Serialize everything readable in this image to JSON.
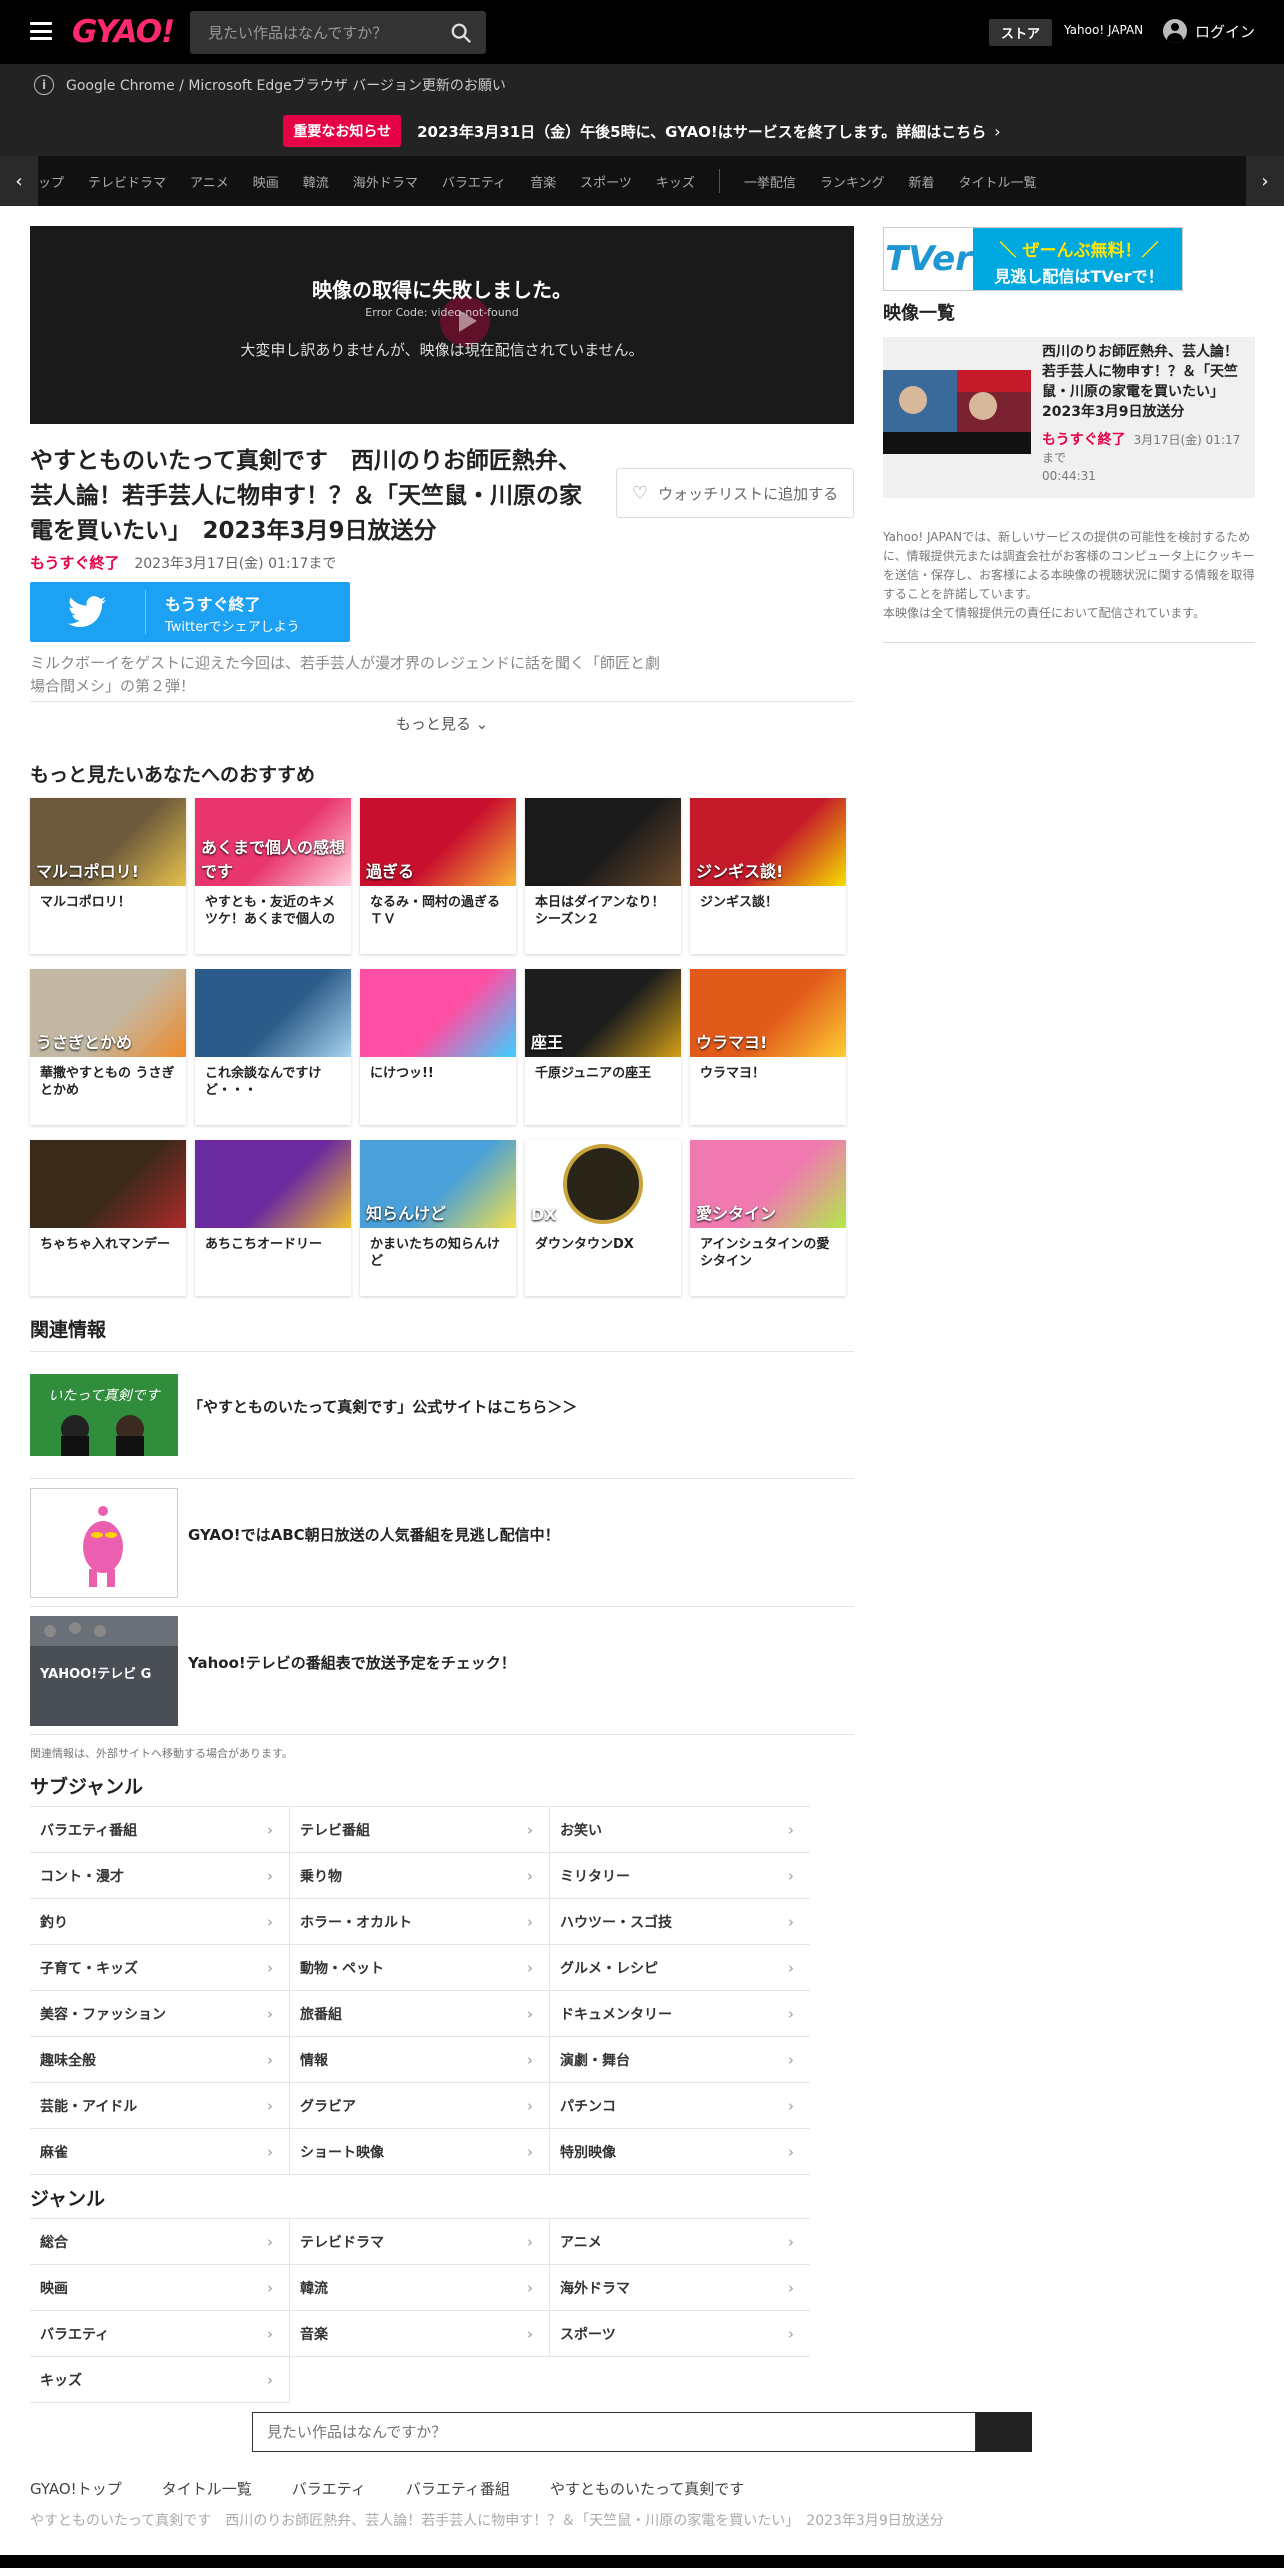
{
  "header": {
    "logo": "GYAO!",
    "search_placeholder": "見たい作品はなんですか？",
    "store": "ストア",
    "yahoo_japan": "Yahoo! JAPAN",
    "login": "ログイン"
  },
  "browser_notice": "Google Chrome / Microsoft Edgeブラウザ バージョン更新のお願い",
  "important_notice": {
    "badge": "重要なお知らせ",
    "text": "2023年3月31日（金）午後5時に、GYAO!はサービスを終了します。詳細はこちら"
  },
  "category_nav": [
    "ップ",
    "テレビドラマ",
    "アニメ",
    "映画",
    "韓流",
    "海外ドラマ",
    "バラエティ",
    "音楽",
    "スポーツ",
    "キッズ",
    "一挙配信",
    "ランキング",
    "新着",
    "タイトル一覧"
  ],
  "player": {
    "title": "映像の取得に失敗しました。",
    "code": "Error Code: video-not-found",
    "message": "大変申し訳ありませんが、映像は現在配信されていません。"
  },
  "episode": {
    "title": "やすとものいたって真剣です　西川のりお師匠熱弁、芸人論！若手芸人に物申す！？＆「天竺鼠・川原の家電を買いたい」　2023年3月9日放送分",
    "status": "もうすぐ終了",
    "until": "2023年3月17日(金) 01:17まで",
    "watchlist": "ウォッチリストに追加する",
    "twitter_main": "もうすぐ終了",
    "twitter_sub": "Twitterでシェアしよう",
    "description": "ミルクボーイをゲストに迎えた今回は、若手芸人が漫才界のレジェンドに話を聞く「師匠と劇場合間メシ」の第２弾！",
    "more": "もっと見る"
  },
  "recommend": {
    "heading": "もっと見たいあなたへのおすすめ",
    "items": [
      {
        "title": "マルコポロリ！",
        "thumb": "マルコポロリ!"
      },
      {
        "title": "やすとも・友近のキメツケ！あくまで個人の",
        "thumb": "あくまで個人の感想です"
      },
      {
        "title": "なるみ・岡村の過ぎるＴＶ",
        "thumb": "過ぎる"
      },
      {
        "title": "本日はダイアンなり！シーズン２",
        "thumb": ""
      },
      {
        "title": "ジンギス談！",
        "thumb": "ジンギス談!"
      },
      {
        "title": "華撒やすともの うさぎとかめ",
        "thumb": "うさぎとかめ"
      },
      {
        "title": "これ余談なんですけど・・・",
        "thumb": ""
      },
      {
        "title": "にけつッ!!",
        "thumb": ""
      },
      {
        "title": "千原ジュニアの座王",
        "thumb": "座王"
      },
      {
        "title": "ウラマヨ！",
        "thumb": "ウラマヨ!"
      },
      {
        "title": "ちゃちゃ入れマンデー",
        "thumb": ""
      },
      {
        "title": "あちこちオードリー",
        "thumb": ""
      },
      {
        "title": "かまいたちの知らんけど",
        "thumb": "知らんけど"
      },
      {
        "title": "ダウンタウンDX",
        "thumb": "DX"
      },
      {
        "title": "アインシュタインの愛シタイン",
        "thumb": "愛シタイン"
      }
    ]
  },
  "related": {
    "heading": "関連情報",
    "items": [
      {
        "text": "「やすとものいたって真剣です」公式サイトはこちら＞＞",
        "thumb": "いたって真剣です"
      },
      {
        "text": "GYAO!ではABC朝日放送の人気番組を見逃し配信中！",
        "thumb": ""
      },
      {
        "text": "Yahoo!テレビの番組表で放送予定をチェック！",
        "thumb": "YAHOO!テレビ G"
      }
    ],
    "note": "関連情報は、外部サイトへ移動する場合があります。"
  },
  "subgenre": {
    "heading": "サブジャンル",
    "items": [
      "バラエティ番組",
      "テレビ番組",
      "お笑い",
      "コント・漫才",
      "乗り物",
      "ミリタリー",
      "釣り",
      "ホラー・オカルト",
      "ハウツー・スゴ技",
      "子育て・キッズ",
      "動物・ペット",
      "グルメ・レシピ",
      "美容・ファッション",
      "旅番組",
      "ドキュメンタリー",
      "趣味全般",
      "情報",
      "演劇・舞台",
      "芸能・アイドル",
      "グラビア",
      "パチンコ",
      "麻雀",
      "ショート映像",
      "特別映像"
    ]
  },
  "genre": {
    "heading": "ジャンル",
    "items": [
      "総合",
      "テレビドラマ",
      "アニメ",
      "映画",
      "韓流",
      "海外ドラマ",
      "バラエティ",
      "音楽",
      "スポーツ",
      "キッズ"
    ]
  },
  "footer": {
    "search_placeholder": "見たい作品はなんですか？",
    "breadcrumbs": [
      "GYAO!トップ",
      "タイトル一覧",
      "バラエティ",
      "バラエティ番組",
      "やすとものいたって真剣です"
    ],
    "current": "やすとものいたって真剣です　西川のりお師匠熱弁、芸人論！若手芸人に物申す！？＆「天竺鼠・川原の家電を買いたい」　2023年3月9日放送分"
  },
  "sidebar": {
    "tver_logo": "TVer",
    "tver_line1": "＼ ぜーんぶ無料！／",
    "tver_line2": "見逃し配信はTVerで！",
    "heading": "映像一覧",
    "card": {
      "title": "西川のりお師匠熱弁、芸人論！若手芸人に物申す！？＆「天竺鼠・川原の家電を買いたい」　2023年3月9日放送分",
      "status": "もうすぐ終了",
      "until": "3月17日(金) 01:17まで",
      "duration": "00:44:31"
    },
    "note": "Yahoo! JAPANでは、新しいサービスの提供の可能性を検討するために、情報提供元または調査会社がお客様のコンピュータ上にクッキーを送信・保存し、お客様による本映像の視聴状況に関する情報を取得することを許諾しています。\n本映像は全て情報提供元の責任において配信されています。"
  },
  "colors": {
    "brand_pink": "#ff2a6d",
    "alert_red": "#e60045",
    "twitter_blue": "#1da1f2",
    "tver_blue": "#00a8e0"
  }
}
